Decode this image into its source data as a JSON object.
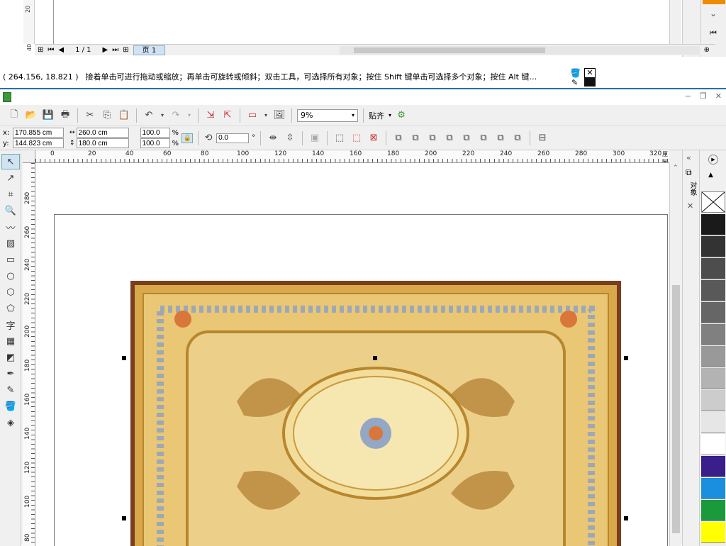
{
  "prev_window": {
    "ruler_ticks": [
      "20",
      "40"
    ],
    "page_indicator": "1 / 1",
    "page_tab": "页 1"
  },
  "status": {
    "coords": "( 264.156, 18.821 )",
    "hint": "接着单击可进行拖动或缩放；再单击可旋转或倾斜；双击工具，可选择所有对象；按住 Shift 键单击可选择多个对象；按住 Alt 键…"
  },
  "toolbar": {
    "zoom_value": "9%",
    "snap_label": "贴齐"
  },
  "property_bar": {
    "x_label": "x:",
    "x_value": "170.855 cm",
    "y_label": "y:",
    "y_value": "144.823 cm",
    "width_value": "260.0 cm",
    "height_value": "180.0 cm",
    "scale_x": "100.0",
    "scale_y": "100.0",
    "percent": "%",
    "rotation_value": "0.0",
    "degree": "°"
  },
  "hruler": {
    "ticks": [
      "0",
      "20",
      "40",
      "60",
      "80",
      "100",
      "120",
      "140",
      "160",
      "180",
      "200",
      "220",
      "240",
      "260",
      "280",
      "300",
      "320"
    ],
    "unit": "厘米"
  },
  "vruler": {
    "ticks": [
      "280",
      "260",
      "240",
      "220",
      "200",
      "180",
      "160",
      "140",
      "120",
      "100",
      "80"
    ]
  },
  "dock": {
    "tab_label": "对象"
  },
  "palette": {
    "colors": [
      "#1a1a1a",
      "#333333",
      "#4d4d4d",
      "#595959",
      "#666666",
      "#808080",
      "#999999",
      "#b3b3b3",
      "#cccccc",
      "#e6e6e6",
      "#ffffff",
      "#3a1e8c",
      "#1a8fe0",
      "#1a9a3a",
      "#ffff00"
    ]
  },
  "colors": {
    "accent": "#2a6fa8",
    "rug_border": "#7a3e1e",
    "rug_field": "#e9c775"
  }
}
